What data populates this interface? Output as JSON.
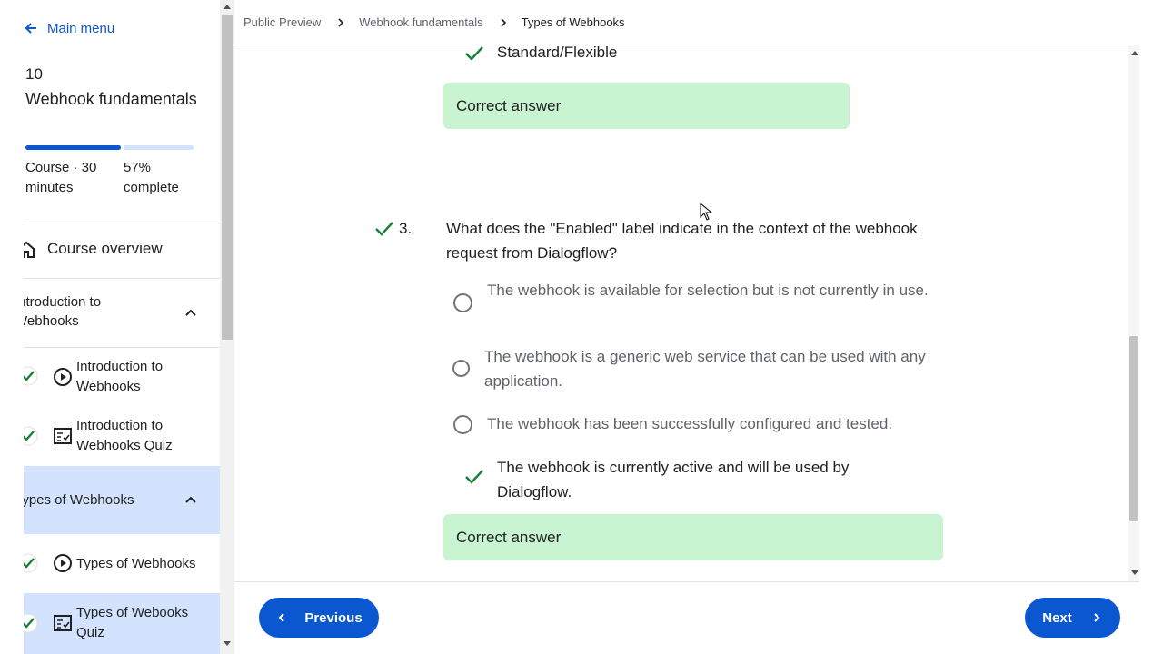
{
  "sidebar": {
    "main_menu": "Main menu",
    "course_number": "10",
    "course_title": "Webhook fundamentals",
    "progress_fraction": 0.57,
    "meta_left": "Course · 30 minutes",
    "meta_right": "57% complete",
    "overview": "Course overview",
    "sections": [
      {
        "label": "Introduction to Webhooks",
        "items": [
          {
            "label": "Introduction to Webhooks",
            "icon": "play-circle-icon"
          },
          {
            "label": "Introduction to Webhooks Quiz",
            "icon": "quiz-icon"
          }
        ]
      },
      {
        "label": "Types of Webhooks",
        "items": [
          {
            "label": "Types of Webhooks",
            "icon": "play-circle-icon"
          },
          {
            "label": "Types of Webooks Quiz",
            "icon": "quiz-icon"
          }
        ]
      }
    ]
  },
  "breadcrumb": {
    "items": [
      "Public Preview",
      "Webhook fundamentals",
      "Types of Webhooks"
    ]
  },
  "quiz": {
    "prev_answer": {
      "text": "Standard/Flexible",
      "feedback": "Correct answer"
    },
    "question": {
      "number": "3.",
      "text": "What does the \"Enabled\" label indicate in the context of the webhook request from Dialogflow?",
      "options": [
        "The webhook is available for selection but is not currently in use.",
        "The webhook is a generic web service that can be used with any application.",
        "The webhook has been successfully configured and tested.",
        "The webhook is currently active and will be used by Dialogflow."
      ],
      "feedback": "Correct answer"
    }
  },
  "footer": {
    "previous": "Previous",
    "next": "Next"
  },
  "colors": {
    "accent": "#0b57d0",
    "correct_bg": "#c9f4d1",
    "check_green": "#188038",
    "selected_bg": "#d3e3fd"
  }
}
